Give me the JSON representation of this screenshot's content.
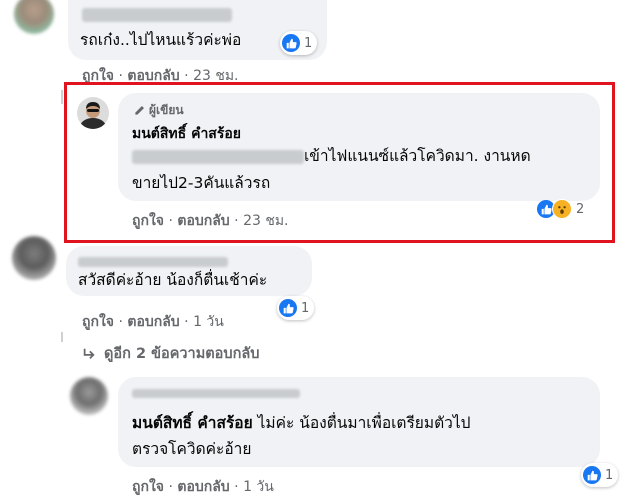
{
  "comments": [
    {
      "text": "รถเก๋ง..ไปไหนแร้วค่ะพ่อ",
      "reactions": "1",
      "meta": {
        "like": "ถูกใจ",
        "reply": "ตอบกลับ",
        "time": "23 ชม."
      }
    },
    {
      "author_badge": "ผู้เขียน",
      "author": "มนต์สิทธิ์ คำสร้อย",
      "text_line1": "เข้าไฟแนนซ์แล้วโควิดมา. งานหด",
      "text_line2": "ขายไป2-3คันแล้วรถ",
      "reactions": "2",
      "meta": {
        "like": "ถูกใจ",
        "reply": "ตอบกลับ",
        "time": "23 ชม."
      }
    },
    {
      "text": "สวัสดีค่ะอ้าย น้องก็ตื่นเช้าค่ะ",
      "reactions": "1",
      "meta": {
        "like": "ถูกใจ",
        "reply": "ตอบกลับ",
        "time": "1 วัน"
      },
      "more_replies": "ดูอีก 2 ข้อความตอบกลับ"
    },
    {
      "mention": "มนต์สิทธิ์ คำสร้อย",
      "text_line1": "ไม่ค่ะ น้องตื่นมาเพื่อเตรียมตัวไป",
      "text_line2": "ตรวจโควิดค่ะอ้าย",
      "reactions": "1",
      "meta": {
        "like": "ถูกใจ",
        "reply": "ตอบกลับ",
        "time": "1 วัน"
      }
    }
  ],
  "colors": {
    "highlight_border": "#e0141e",
    "bubble": "#f0f2f5",
    "meta_text": "#65676b",
    "like_blue": "#1877f2"
  },
  "icons": [
    "like-icon",
    "wow-icon",
    "pencil-icon",
    "reply-arrow-icon"
  ]
}
